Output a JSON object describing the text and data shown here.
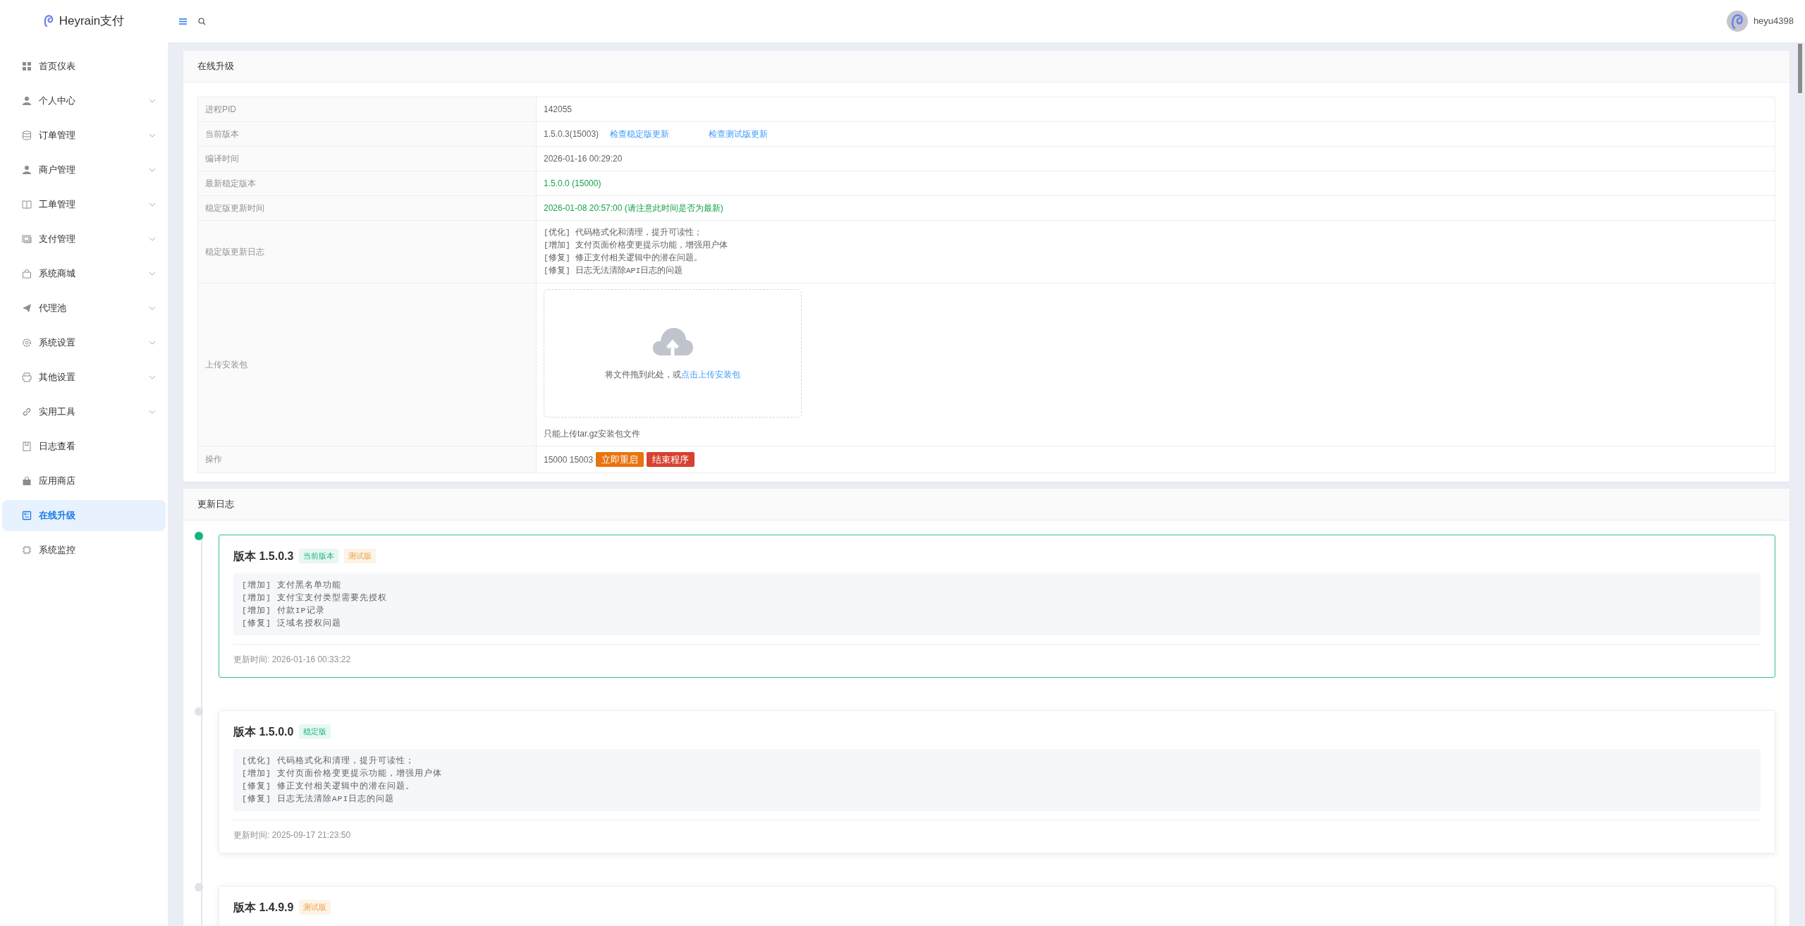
{
  "header": {
    "brand": "Heyrain支付",
    "user": "heyu4398"
  },
  "sidebar": {
    "items": [
      {
        "label": "首页仪表",
        "expandable": false,
        "selected": false
      },
      {
        "label": "个人中心",
        "expandable": true,
        "selected": false
      },
      {
        "label": "订单管理",
        "expandable": true,
        "selected": false
      },
      {
        "label": "商户管理",
        "expandable": true,
        "selected": false
      },
      {
        "label": "工单管理",
        "expandable": true,
        "selected": false
      },
      {
        "label": "支付管理",
        "expandable": true,
        "selected": false
      },
      {
        "label": "系统商城",
        "expandable": true,
        "selected": false
      },
      {
        "label": "代理池",
        "expandable": true,
        "selected": false
      },
      {
        "label": "系统设置",
        "expandable": true,
        "selected": false
      },
      {
        "label": "其他设置",
        "expandable": true,
        "selected": false
      },
      {
        "label": "实用工具",
        "expandable": true,
        "selected": false
      },
      {
        "label": "日志查看",
        "expandable": false,
        "selected": false
      },
      {
        "label": "应用商店",
        "expandable": false,
        "selected": false
      },
      {
        "label": "在线升级",
        "expandable": false,
        "selected": true
      },
      {
        "label": "系统监控",
        "expandable": false,
        "selected": false
      }
    ]
  },
  "upgrade_panel": {
    "title": "在线升级",
    "rows": [
      {
        "kind": "text",
        "label": "进程PID",
        "value": "142055"
      },
      {
        "kind": "links",
        "label": "当前版本",
        "value": "1.5.0.3(15003)",
        "links": [
          "检查稳定版更新",
          "检查测试版更新"
        ]
      },
      {
        "kind": "text",
        "label": "编译时间",
        "value": "2026-01-16 00:29:20"
      },
      {
        "kind": "success",
        "label": "最新稳定版本",
        "value": "1.5.0.0 (15000)"
      },
      {
        "kind": "success",
        "label": "稳定版更新时间",
        "value": "2026-01-08 20:57:00 (请注意此时间是否为最新)"
      },
      {
        "kind": "log",
        "label": "稳定版更新日志",
        "lines": [
          "[优化] 代码格式化和清理，提升可读性；",
          "[增加] 支付页面价格变更提示功能，增强用户体",
          "[修复] 修正支付相关逻辑中的潜在问题。",
          "[修复] 日志无法清除API日志的问题"
        ]
      },
      {
        "kind": "upload",
        "label": "上传安装包",
        "prompt": "将文件拖到此处，或",
        "link": "点击上传安装包",
        "tip": "只能上传tar.gz安装包文件"
      },
      {
        "kind": "actions",
        "label": "操作",
        "value": "15000 15003",
        "buttons": [
          {
            "label": "立即重启",
            "kind": "warning"
          },
          {
            "label": "结束程序",
            "kind": "danger"
          }
        ]
      }
    ]
  },
  "changelog": {
    "title": "更新日志",
    "entries": [
      {
        "version": "版本 1.5.0.3",
        "current": true,
        "tags": [
          {
            "label": "当前版本",
            "kind": "success"
          },
          {
            "label": "测试版",
            "kind": "warning"
          }
        ],
        "lines": [
          "[增加] 支付黑名单功能",
          "[增加] 支付宝支付类型需要先授权",
          "[增加] 付款IP记录",
          "[修复] 泛域名授权问题"
        ],
        "time": "更新时间: 2026-01-16 00:33:22"
      },
      {
        "version": "版本 1.5.0.0",
        "current": false,
        "tags": [
          {
            "label": "稳定版",
            "kind": "success"
          }
        ],
        "lines": [
          "[优化] 代码格式化和清理，提升可读性；",
          "[增加] 支付页面价格变更提示功能，增强用户体",
          "[修复] 修正支付相关逻辑中的潜在问题。",
          "[修复] 日志无法清除API日志的问题"
        ],
        "time": "更新时间: 2025-09-17 21:23:50"
      },
      {
        "version": "版本 1.4.9.9",
        "current": false,
        "tags": [
          {
            "label": "测试版",
            "kind": "warning"
          }
        ]
      }
    ]
  }
}
